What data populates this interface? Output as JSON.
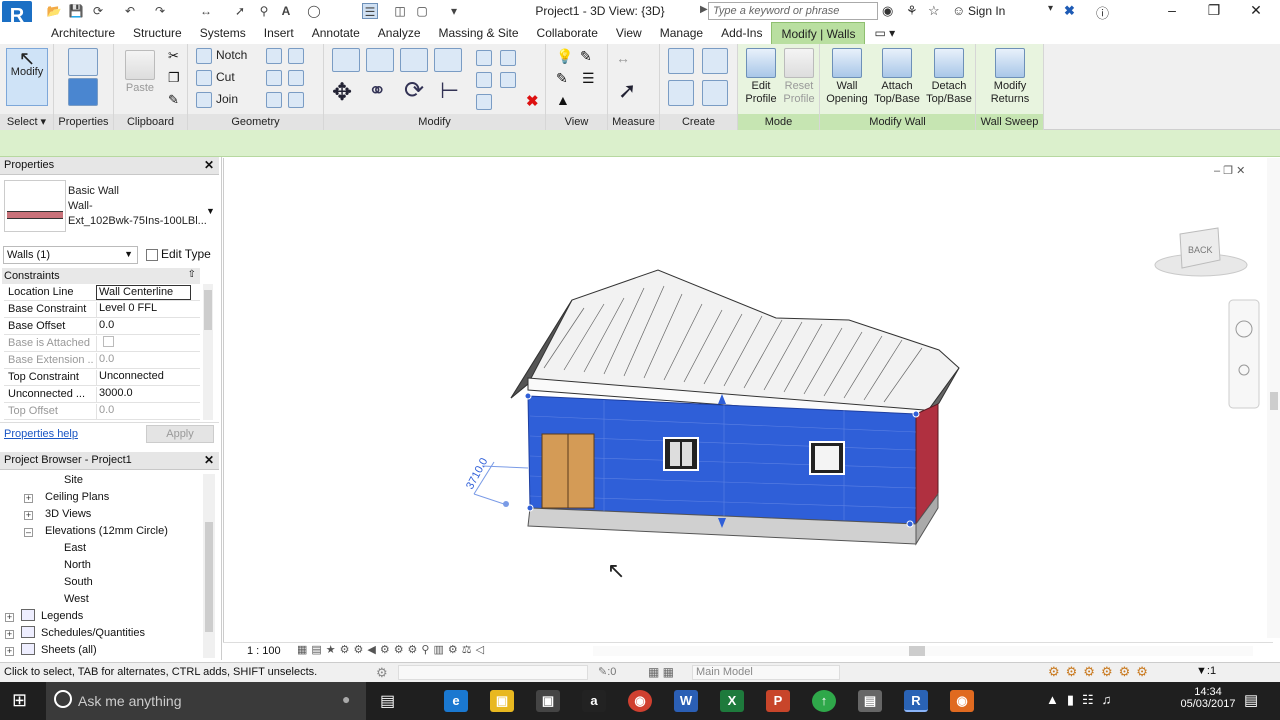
{
  "titlebar": {
    "app_letter": "R",
    "document_title": "Project1 - 3D View: {3D}",
    "search_placeholder": "Type a keyword or phrase",
    "sign_in": "Sign In"
  },
  "ribbon_tabs": [
    "Architecture",
    "Structure",
    "Systems",
    "Insert",
    "Annotate",
    "Analyze",
    "Massing & Site",
    "Collaborate",
    "View",
    "Manage",
    "Add-Ins",
    "Modify | Walls"
  ],
  "ribbon": {
    "modify_label": "Modify",
    "properties_panel": "Properties",
    "paste_label": "Paste",
    "clipboard_panel": "Clipboard",
    "notch_label": "Notch",
    "cut_label": "Cut",
    "join_label": "Join",
    "geometry_panel": "Geometry",
    "modify_panel": "Modify",
    "view_panel": "View",
    "measure_panel": "Measure",
    "create_panel": "Create",
    "edit_profile": "Edit Profile",
    "reset_profile": "Reset Profile",
    "mode_panel": "Mode",
    "wall_opening": "Wall Opening",
    "attach_top_base": "Attach Top/Base",
    "detach_top_base": "Detach Top/Base",
    "modify_wall_panel": "Modify Wall",
    "modify_returns": "Modify Returns",
    "wall_sweep_panel": "Wall Sweep",
    "select_label": "Select",
    "properties_label": "Properties"
  },
  "properties": {
    "title": "Properties",
    "type_family": "Basic Wall",
    "type_name_1": "Wall-",
    "type_name_2": "Ext_102Bwk-75Ins-100LBl...",
    "instance_filter": "Walls (1)",
    "edit_type": "Edit Type",
    "group": "Constraints",
    "rows": [
      {
        "k": "Location Line",
        "v": "Wall Centerline"
      },
      {
        "k": "Base Constraint",
        "v": "Level 0 FFL"
      },
      {
        "k": "Base Offset",
        "v": "0.0"
      },
      {
        "k": "Base is Attached",
        "v": ""
      },
      {
        "k": "Base Extension ...",
        "v": "0.0"
      },
      {
        "k": "Top Constraint",
        "v": "Unconnected"
      },
      {
        "k": "Unconnected ...",
        "v": "3000.0"
      },
      {
        "k": "Top Offset",
        "v": "0.0"
      }
    ],
    "help_link": "Properties help",
    "apply": "Apply"
  },
  "browser": {
    "title": "Project Browser - Project1",
    "items": [
      "Site",
      "Ceiling Plans",
      "3D Views",
      "Elevations (12mm Circle)",
      "East",
      "North",
      "South",
      "West",
      "Legends",
      "Schedules/Quantities",
      "Sheets (all)"
    ]
  },
  "viewport": {
    "dimension_value": "3710.0",
    "viewcube_face": "BACK",
    "scale": "1 : 100"
  },
  "status": {
    "hint": "Click to select, TAB for alternates, CTRL adds, SHIFT unselects.",
    "select_count": ":0",
    "model": "Main Model",
    "filter_count": ":1"
  },
  "taskbar": {
    "search": "Ask me anything",
    "time": "14:34",
    "date": "05/03/2017"
  },
  "colors": {
    "selected_wall": "#2f5fd8",
    "ribbon_context": "#b9dfa0",
    "taskbar": "#1f1f1f"
  }
}
